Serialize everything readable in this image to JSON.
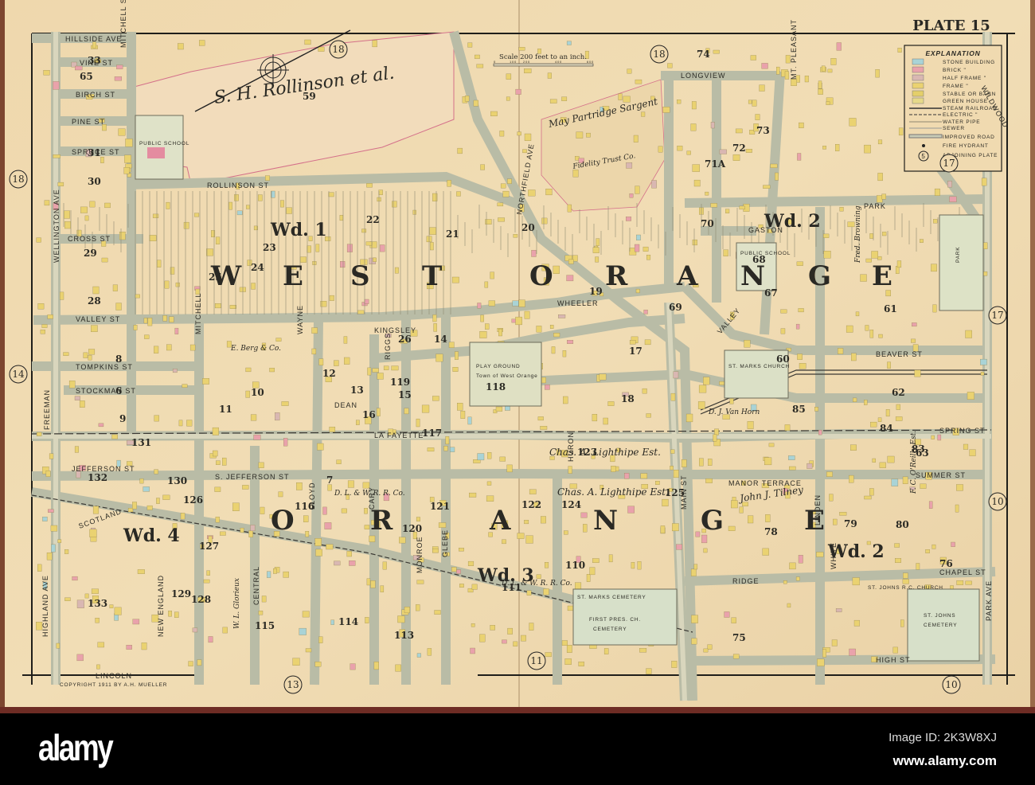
{
  "plate_title": "PLATE 15",
  "scale": {
    "text": "Scale 200 feet to an inch.",
    "ticks": [
      "0",
      "100",
      "200",
      "400",
      "600"
    ]
  },
  "copyright": "COPYRIGHT 1911 BY A.H. MUELLER",
  "legend": {
    "title": "EXPLANATION",
    "items": [
      "STONE BUILDING",
      "BRICK \"",
      "HALF FRAME \"",
      "FRAME \"",
      "STABLE OR BARN",
      "GREEN HOUSE",
      "STEAM RAILROAD",
      "ELECTRIC \"",
      "WATER PIPE",
      "SEWER",
      "IMPROVED ROAD",
      "FIRE HYDRANT",
      "ADJOINING PLATE"
    ],
    "sample_plate": "5",
    "colors": {
      "stone": "#a9d3d6",
      "brick": "#e9a2ab",
      "half_frame": "#d9b7b2",
      "frame": "#ead271",
      "stable": "#e4cf6a",
      "green_house": "#e6d98a"
    }
  },
  "town_labels": {
    "west_orange": [
      "W",
      "E",
      "S",
      "T",
      "O",
      "R",
      "A",
      "N",
      "G",
      "E"
    ],
    "orange": [
      "O",
      "R",
      "A",
      "N",
      "G",
      "E"
    ]
  },
  "wards": [
    "Wd. 1",
    "Wd. 2",
    "Wd. 2",
    "Wd. 3",
    "Wd. 4"
  ],
  "adjoining_plates": [
    "18",
    "18",
    "18",
    "17",
    "17",
    "14",
    "13",
    "11",
    "10",
    "10"
  ],
  "streets": [
    "HILLSIDE AVE",
    "VINE ST",
    "BIRCH ST",
    "PINE ST",
    "SPRUCE ST",
    "CROSS ST",
    "WELLINGTON AVE",
    "MITCHELL ST",
    "ROLLINSON ST",
    "VALLEY ST",
    "TOMPKINS ST",
    "STOCKMAN ST",
    "FREEMAN",
    "JEFFERSON ST",
    "S. JEFFERSON ST",
    "LA FAYETTE",
    "SCOTLAND",
    "HIGHLAND AVE",
    "LINCOLN",
    "CENTRAL",
    "NEW ENGLAND",
    "MITCHELL",
    "LLOYD",
    "CARY",
    "GLEBE",
    "NORTHFIELD AVE",
    "MAIN ST",
    "VALLEY",
    "WHEELER",
    "KINGSLEY",
    "GASTON",
    "LONGVIEW",
    "PARK",
    "WILDWOOD",
    "MT. PLEASANT",
    "BEAVER ST",
    "SPRING ST",
    "SUMMER ST",
    "CHAPEL ST",
    "RIDGE",
    "HIGH ST",
    "MANOR TERRACE",
    "WHITE",
    "LINDEN",
    "PARK AVE",
    "DEAN",
    "RIGGS",
    "MONROE",
    "HURON",
    "WAYNE"
  ],
  "owners": [
    "S. H. Rollinson et al.",
    "May Partridge Sargent",
    "Fidelity Trust Co.",
    "Chas. A. Lighthipe Est.",
    "Chas. A. Lighthipe Est.",
    "D. L. & W. R. R. Co.",
    "D. L. & W. R. R. Co.",
    "John J. Tilney",
    "W. L. Glorieux",
    "Fred. Browning",
    "E. Berg & Co.",
    "D. J. Van Horn",
    "F. C. O'Reilly Est."
  ],
  "landmarks": [
    "PUBLIC SCHOOL",
    "PUBLIC SCHOOL",
    "PLAY GROUND",
    "Town of West Orange",
    "ST. MARKS CHURCH",
    "ST. MARKS CEMETERY",
    "FIRST PRES. CH.",
    "CEMETERY",
    "ST. JOHNS",
    "CEMETERY",
    "PARK",
    "ST. JOHNS R.C. CHURCH"
  ],
  "blocks": [
    "33",
    "31",
    "30",
    "29",
    "28",
    "59",
    "74",
    "73",
    "72",
    "71A",
    "70",
    "68",
    "67",
    "69",
    "60",
    "61",
    "62",
    "63",
    "80",
    "79",
    "78",
    "76",
    "75",
    "85",
    "84",
    "83",
    "123",
    "125",
    "124",
    "122",
    "121",
    "120",
    "119",
    "116",
    "115",
    "114",
    "113",
    "110",
    "111",
    "129",
    "128",
    "127",
    "126",
    "130",
    "131",
    "132",
    "133",
    "17",
    "18",
    "19",
    "20",
    "21",
    "22",
    "23",
    "24",
    "25",
    "26",
    "14",
    "15",
    "16",
    "13",
    "12",
    "11",
    "10",
    "9",
    "8",
    "6",
    "7",
    "117",
    "118",
    "65"
  ],
  "watermark": {
    "logo": "alamy",
    "image_id": "Image ID: 2K3W8XJ",
    "site": "www.alamy.com"
  }
}
